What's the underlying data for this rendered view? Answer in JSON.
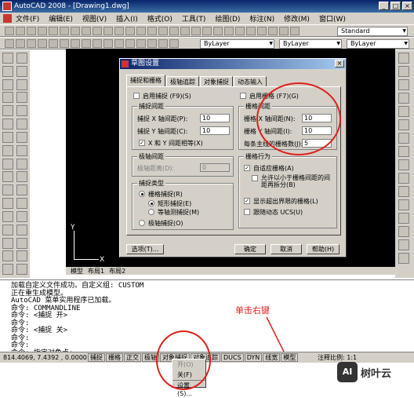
{
  "window": {
    "title": "AutoCAD 2008 - [Drawing1.dwg]",
    "buttons": [
      "_",
      "□",
      "×"
    ]
  },
  "menubar": [
    "文件(F)",
    "编辑(E)",
    "视图(V)",
    "插入(I)",
    "格式(O)",
    "工具(T)",
    "绘图(D)",
    "标注(N)",
    "修改(M)",
    "窗口(W)"
  ],
  "toolbar": {
    "style_combo": "Standard",
    "layer_combo": "ByLayer",
    "linetype_combo": "ByLayer",
    "lineweight_combo": "ByLayer"
  },
  "canvas": {
    "ucs_y": "Y",
    "ucs_x": "X"
  },
  "layout_tabs": [
    "模型",
    "布局1",
    "布局2"
  ],
  "dialog": {
    "title": "草图设置",
    "close": "×",
    "tabs": [
      "捕捉和栅格",
      "极轴追踪",
      "对象捕捉",
      "动态输入"
    ],
    "snap_on_label": "启用捕捉 (F9)(S)",
    "snap_spacing_group": "捕捉间距",
    "snap_x_label": "捕捉 X 轴间距(P):",
    "snap_x_value": "10",
    "snap_y_label": "捕捉 Y 轴间距(C):",
    "snap_y_value": "10",
    "xy_equal_label": "X 和 Y 间距相等(X)",
    "polar_group": "极轴间距",
    "polar_distance_label": "极轴距离(D):",
    "polar_distance_value": "0",
    "snap_type_group": "捕捉类型",
    "grid_snap_label": "栅格捕捉(R)",
    "rect_snap_label": "矩形捕捉(E)",
    "iso_snap_label": "等轴测捕捉(M)",
    "polar_snap_label": "极轴捕捉(O)",
    "grid_on_label": "启用栅格 (F7)(G)",
    "grid_spacing_group": "栅格间距",
    "grid_x_label": "栅格 X 轴间距(N):",
    "grid_x_value": "10",
    "grid_y_label": "栅格 Y 轴间距(I):",
    "grid_y_value": "10",
    "major_line_label": "每条主线的栅格数(J):",
    "major_line_value": "5",
    "grid_behavior_group": "栅格行为",
    "adaptive_label": "自适应栅格(A)",
    "subdivide_label": "允许以小于栅格间距的间距再拆分(B)",
    "beyond_limits_label": "显示超出界限的栅格(L)",
    "follow_ucs_label": "跟随动态 UCS(U)",
    "options_btn": "选项(T)...",
    "ok_btn": "确定",
    "cancel_btn": "取消",
    "help_btn": "帮助(H)"
  },
  "command_lines": [
    "加载自定义文件成功。自定义组: CUSTOM",
    "正在重生成模型。",
    "AutoCAD 菜单实用程序已加载。",
    "命令: COMMANDLINE",
    "命令: <捕捉 开>",
    "命令:",
    "命令: <捕捉 关>",
    "命令:",
    "命令:",
    "命令: 指定对角点:",
    "命令:"
  ],
  "statusbar": {
    "coords": "814.4069, 7.4392 , 0.0000",
    "buttons": [
      "捕捉",
      "栅格",
      "正交",
      "极轴",
      "对象捕捉",
      "对象追踪",
      "DUCS",
      "DYN",
      "线宽",
      "模型"
    ],
    "scale_label": "注释比例: 1:1"
  },
  "context_menu": [
    "开(O)",
    "关(F)",
    "设置(S)..."
  ],
  "annotation": "单击右键",
  "watermark": {
    "logo": "AI",
    "text": "树叶云"
  },
  "colors": {
    "title_blue": "#0a246a",
    "annotation_red": "#e0201c",
    "canvas": "#000000",
    "face": "#d4d0c8"
  }
}
